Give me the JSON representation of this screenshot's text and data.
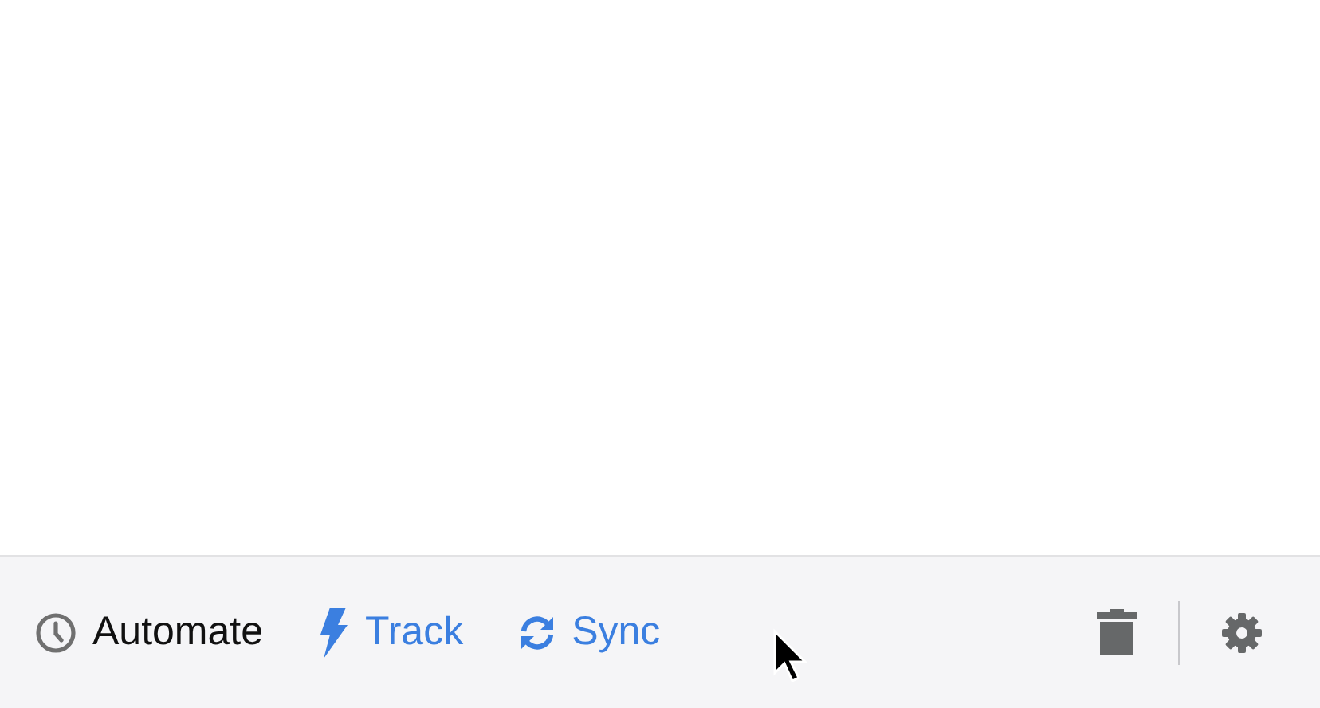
{
  "toolbar": {
    "actions": [
      {
        "kind": "clock",
        "label": "Automate",
        "color": "#111111"
      },
      {
        "kind": "bolt",
        "label": "Track",
        "color": "#3b7fe0"
      },
      {
        "kind": "sync",
        "label": "Sync",
        "color": "#3b7fe0"
      }
    ]
  }
}
